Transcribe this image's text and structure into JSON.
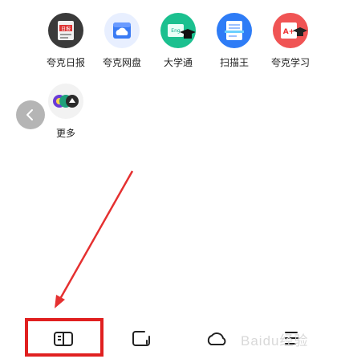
{
  "apps": [
    {
      "label": "夸克日报",
      "icon": "daily-news-icon",
      "badge_text": "日报"
    },
    {
      "label": "夸克网盘",
      "icon": "cloud-drive-icon"
    },
    {
      "label": "大学通",
      "icon": "graduation-cap-icon",
      "badge_text": "Eng"
    },
    {
      "label": "扫描王",
      "icon": "scanner-icon"
    },
    {
      "label": "夸克学习",
      "icon": "study-icon",
      "badge_text": "A+"
    },
    {
      "label": "更多",
      "icon": "more-apps-icon"
    }
  ],
  "bottom_nav": [
    {
      "name": "reader",
      "icon": "book-icon"
    },
    {
      "name": "crop",
      "icon": "crop-frame-icon"
    },
    {
      "name": "cloud",
      "icon": "cloud-icon"
    },
    {
      "name": "menu",
      "icon": "menu-icon"
    }
  ],
  "annotation": {
    "color": "#e02020"
  },
  "watermark": {
    "text": "Baidu经验"
  }
}
